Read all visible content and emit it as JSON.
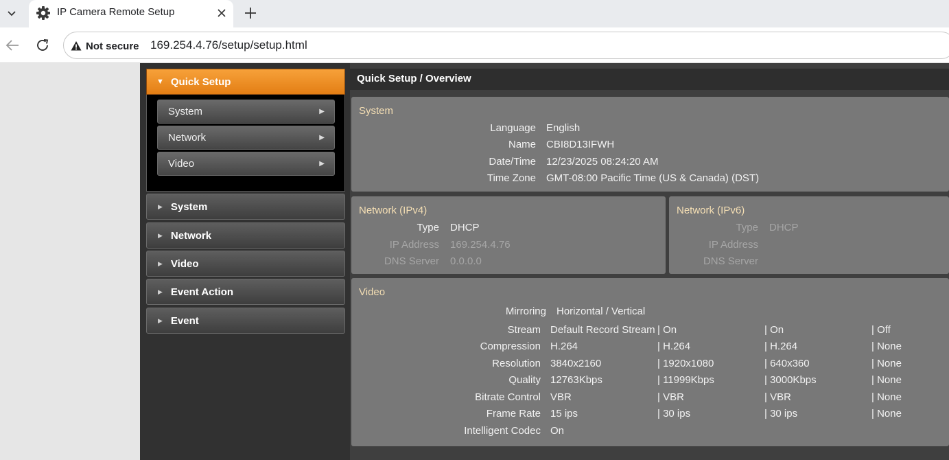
{
  "browser": {
    "tab_title": "IP Camera Remote Setup",
    "security_label": "Not secure",
    "url": "169.254.4.76/setup/setup.html",
    "icons": {
      "tab_menu": "chevron-down-icon",
      "favicon": "gear-icon",
      "close": "close-icon",
      "new_tab": "plus-icon",
      "back": "back-arrow-icon",
      "reload": "reload-icon",
      "warning": "warning-icon"
    }
  },
  "sidebar": {
    "quick_setup": {
      "label": "Quick Setup",
      "items": [
        {
          "label": "System"
        },
        {
          "label": "Network"
        },
        {
          "label": "Video"
        }
      ]
    },
    "menu": [
      {
        "label": "System"
      },
      {
        "label": "Network"
      },
      {
        "label": "Video"
      },
      {
        "label": "Event Action"
      },
      {
        "label": "Event"
      }
    ]
  },
  "content": {
    "header": "Quick Setup / Overview",
    "system": {
      "title": "System",
      "rows": [
        {
          "label": "Language",
          "value": "English"
        },
        {
          "label": "Name",
          "value": "CBI8D13IFWH"
        },
        {
          "label": "Date/Time",
          "value": "12/23/2025 08:24:20 AM"
        },
        {
          "label": "Time Zone",
          "value": "GMT-08:00 Pacific Time (US & Canada) (DST)"
        }
      ]
    },
    "network_ipv4": {
      "title": "Network (IPv4)",
      "rows": [
        {
          "label": "Type",
          "value": "DHCP"
        },
        {
          "label": "IP Address",
          "value": "169.254.4.76"
        },
        {
          "label": "DNS Server",
          "value": "0.0.0.0"
        }
      ]
    },
    "network_ipv6": {
      "title": "Network (IPv6)",
      "rows": [
        {
          "label": "Type",
          "value": "DHCP"
        },
        {
          "label": "IP Address",
          "value": ""
        },
        {
          "label": "DNS Server",
          "value": ""
        }
      ]
    },
    "video": {
      "title": "Video",
      "mirroring": {
        "label": "Mirroring",
        "value": "Horizontal / Vertical"
      },
      "rows": [
        {
          "label": "Stream",
          "values": [
            "Default Record Stream",
            "| On",
            "| On",
            "| Off"
          ]
        },
        {
          "label": "Compression",
          "values": [
            "H.264",
            "| H.264",
            "| H.264",
            "| None"
          ]
        },
        {
          "label": "Resolution",
          "values": [
            "3840x2160",
            "| 1920x1080",
            "| 640x360",
            "| None"
          ]
        },
        {
          "label": "Quality",
          "values": [
            "12763Kbps",
            "| 11999Kbps",
            "| 3000Kbps",
            "| None"
          ]
        },
        {
          "label": "Bitrate Control",
          "values": [
            "VBR",
            "| VBR",
            "| VBR",
            "| None"
          ]
        },
        {
          "label": "Frame Rate",
          "values": [
            "15 ips",
            "| 30 ips",
            "| 30 ips",
            "| None"
          ]
        },
        {
          "label": "Intelligent Codec",
          "values": [
            "On",
            "",
            "",
            ""
          ]
        }
      ]
    }
  }
}
